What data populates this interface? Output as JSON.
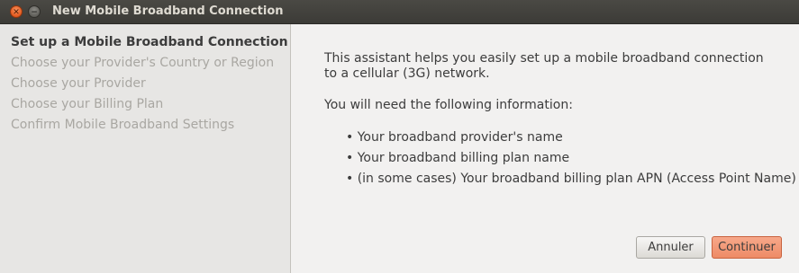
{
  "window": {
    "title": "New Mobile Broadband Connection",
    "close_glyph": "✕",
    "minimize_glyph": "−"
  },
  "sidebar": {
    "steps": [
      {
        "label": "Set up a Mobile Broadband Connection",
        "active": true
      },
      {
        "label": "Choose your Provider's Country or Region",
        "active": false
      },
      {
        "label": "Choose your Provider",
        "active": false
      },
      {
        "label": "Choose your Billing Plan",
        "active": false
      },
      {
        "label": "Confirm Mobile Broadband Settings",
        "active": false
      }
    ]
  },
  "main": {
    "intro": "This assistant helps you easily set up a mobile broadband connection to a cellular (3G) network.",
    "need_heading": "You will need the following information:",
    "bullets": [
      "• Your broadband provider's name",
      "• Your broadband billing plan name",
      "• (in some cases) Your broadband billing plan APN (Access Point Name)"
    ]
  },
  "buttons": {
    "cancel_label": "Annuler",
    "continue_label": "Continuer"
  },
  "colors": {
    "titlebar": "#3c3b37",
    "close_button": "#e45a1f",
    "continue_button": "#ee8b66"
  }
}
